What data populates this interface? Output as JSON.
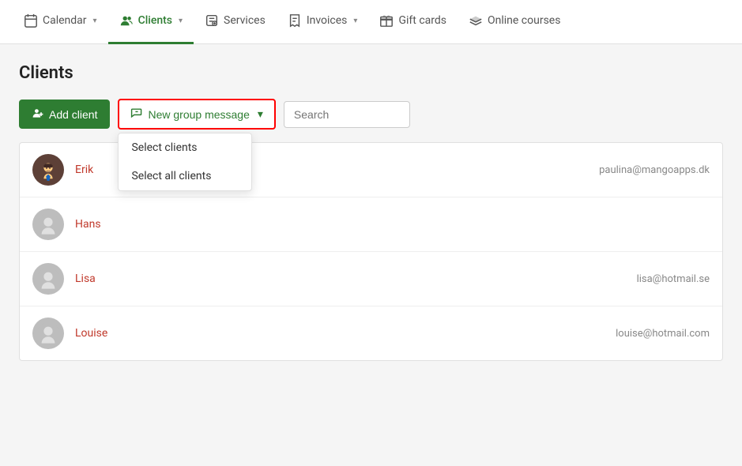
{
  "nav": {
    "items": [
      {
        "id": "calendar",
        "label": "Calendar",
        "icon": "calendar-icon",
        "hasChevron": true,
        "active": false
      },
      {
        "id": "clients",
        "label": "Clients",
        "icon": "clients-icon",
        "hasChevron": true,
        "active": true
      },
      {
        "id": "services",
        "label": "Services",
        "icon": "services-icon",
        "hasChevron": false,
        "active": false
      },
      {
        "id": "invoices",
        "label": "Invoices",
        "icon": "invoices-icon",
        "hasChevron": true,
        "active": false
      },
      {
        "id": "giftcards",
        "label": "Gift cards",
        "icon": "giftcards-icon",
        "hasChevron": false,
        "active": false
      },
      {
        "id": "courses",
        "label": "Online courses",
        "icon": "courses-icon",
        "hasChevron": false,
        "active": false
      }
    ]
  },
  "page": {
    "title": "Clients"
  },
  "toolbar": {
    "add_client_label": "Add client",
    "group_message_label": "New group message",
    "chevron": "▾"
  },
  "dropdown": {
    "items": [
      {
        "id": "select-clients",
        "label": "Select clients"
      },
      {
        "id": "select-all-clients",
        "label": "Select all clients"
      }
    ]
  },
  "search": {
    "placeholder": "Search"
  },
  "clients": [
    {
      "id": "erik",
      "name": "Erik",
      "email": "paulina@mangoapps.dk",
      "has_avatar": true
    },
    {
      "id": "hans",
      "name": "Hans",
      "email": "",
      "has_avatar": false
    },
    {
      "id": "lisa",
      "name": "Lisa",
      "email": "lisa@hotmail.se",
      "has_avatar": false
    },
    {
      "id": "louise",
      "name": "Louise",
      "email": "louise@hotmail.com",
      "has_avatar": false
    }
  ]
}
